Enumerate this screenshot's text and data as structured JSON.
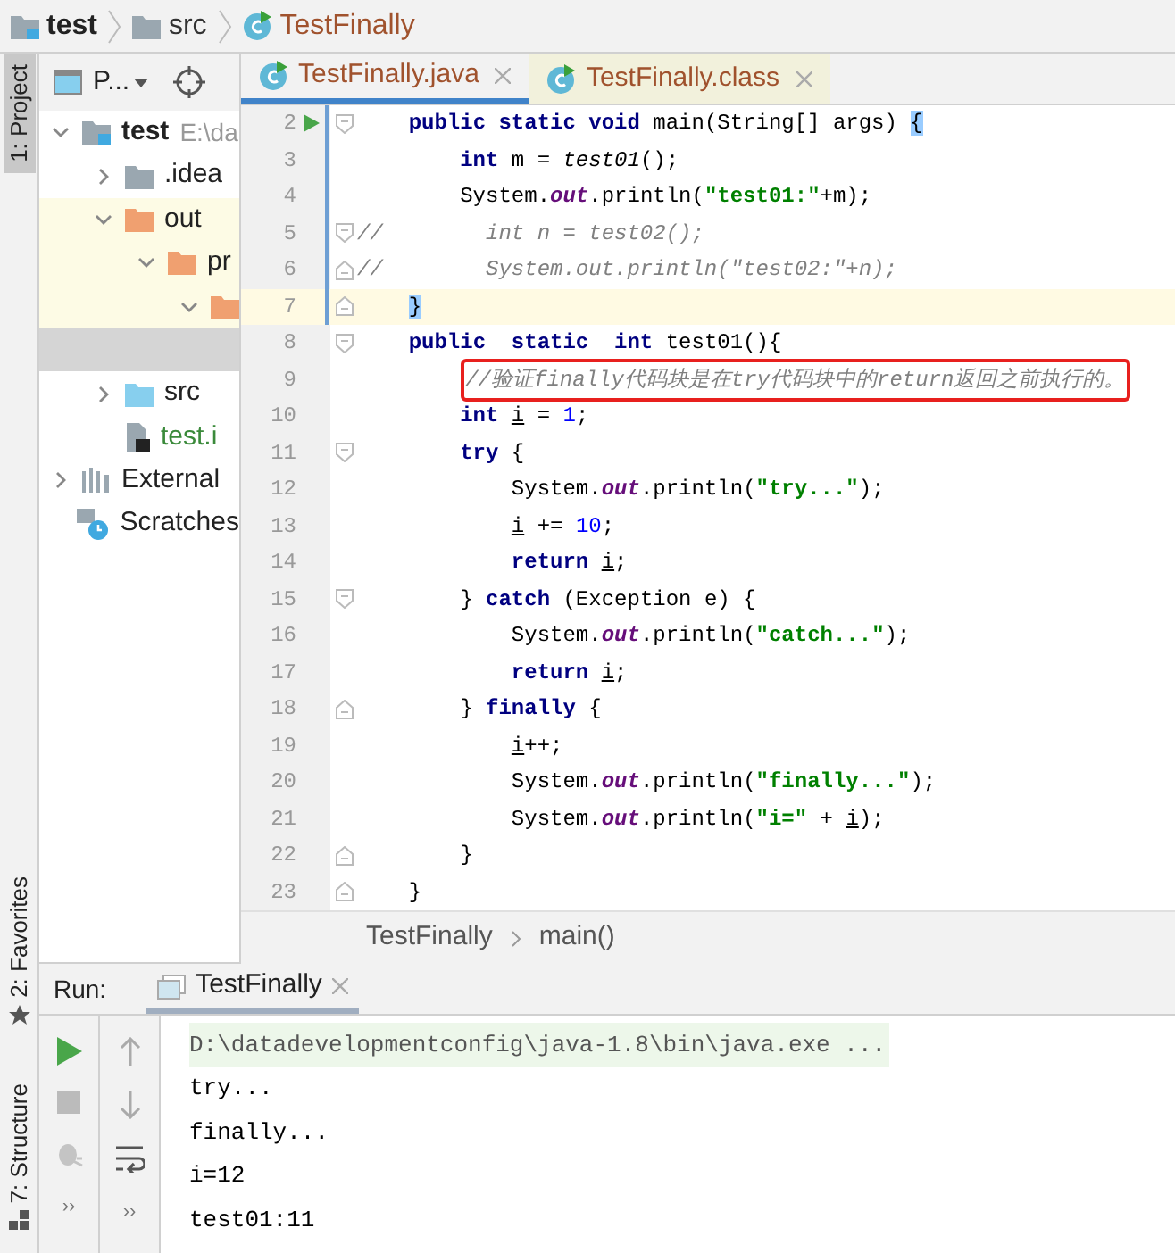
{
  "breadcrumb": [
    {
      "label": "test",
      "kind": "module"
    },
    {
      "label": "src",
      "kind": "folder"
    },
    {
      "label": "TestFinally",
      "kind": "class"
    }
  ],
  "side_tabs_top": [
    {
      "label": "1: Project",
      "selected": true
    }
  ],
  "side_tabs_bottom": [
    {
      "label": "2: Favorites",
      "kind": "star",
      "selected": false
    },
    {
      "label": "7: Structure",
      "kind": "structure",
      "selected": false
    }
  ],
  "project_panel": {
    "title": "P...",
    "tree": [
      {
        "label": "test",
        "hint": "E:\\da",
        "kind": "module",
        "expanded": true,
        "selected": false,
        "excluded": false,
        "children": [
          {
            "label": ".idea",
            "kind": "folder",
            "expanded": false,
            "selected": false,
            "excluded": false
          },
          {
            "label": "out",
            "kind": "excluded",
            "expanded": true,
            "selected": false,
            "excluded": true,
            "children": [
              {
                "label": "pr",
                "kind": "excluded",
                "expanded": true,
                "selected": false,
                "excluded": true,
                "children": [
                  {
                    "kind": "excluded",
                    "expanded": true,
                    "selected": false,
                    "excluded": true,
                    "children": [
                      {
                        "selected": true
                      }
                    ]
                  }
                ]
              }
            ]
          },
          {
            "label": "src",
            "kind": "source",
            "expanded": false,
            "selected": false,
            "excluded": false
          },
          {
            "label": "test.i",
            "kind": "file",
            "selected": false,
            "excluded": false,
            "green": true
          }
        ]
      },
      {
        "label": "External",
        "kind": "library",
        "expanded": false,
        "selected": false,
        "excluded": false
      },
      {
        "label": "Scratches",
        "kind": "scratches",
        "selected": false,
        "excluded": false
      }
    ]
  },
  "editor_tabs": [
    {
      "label": "TestFinally.java",
      "selected": true
    },
    {
      "label": "TestFinally.class",
      "selected": false
    }
  ],
  "code_lines": [
    {
      "number": "2",
      "run": true,
      "fold_open": true,
      "fold_close": false,
      "modified": true,
      "current": false,
      "annotated": false,
      "tokens": [
        {
          "kind": "kw",
          "text": "    public static void "
        },
        {
          "kind": "plain",
          "text": "main(String[] args) "
        },
        {
          "kind": "match",
          "text": "{"
        }
      ]
    },
    {
      "number": "3",
      "run": false,
      "fold_open": false,
      "fold_close": false,
      "modified": true,
      "current": false,
      "annotated": false,
      "tokens": [
        {
          "kind": "kw",
          "text": "        int "
        },
        {
          "kind": "plain",
          "text": "m = "
        },
        {
          "kind": "call",
          "text": "test01"
        },
        {
          "kind": "plain",
          "text": "();"
        }
      ]
    },
    {
      "number": "4",
      "run": false,
      "fold_open": false,
      "fold_close": false,
      "modified": true,
      "current": false,
      "annotated": false,
      "tokens": [
        {
          "kind": "plain",
          "text": "        System."
        },
        {
          "kind": "field",
          "text": "out"
        },
        {
          "kind": "plain",
          "text": ".println("
        },
        {
          "kind": "str",
          "text": "\"test01:\""
        },
        {
          "kind": "plain",
          "text": "+m);"
        }
      ]
    },
    {
      "number": "5",
      "run": false,
      "fold_open": true,
      "fold_close": false,
      "modified": true,
      "current": false,
      "annotated": false,
      "tokens": [
        {
          "kind": "comment",
          "text": "//        int n = test02();"
        }
      ]
    },
    {
      "number": "6",
      "run": false,
      "fold_open": false,
      "fold_close": true,
      "modified": true,
      "current": false,
      "annotated": false,
      "tokens": [
        {
          "kind": "comment",
          "text": "//        System.out.println(\"test02:\"+n);"
        }
      ]
    },
    {
      "number": "7",
      "run": false,
      "fold_open": false,
      "fold_close": true,
      "modified": true,
      "current": true,
      "annotated": false,
      "tokens": [
        {
          "kind": "match",
          "text": "    }"
        }
      ]
    },
    {
      "number": "8",
      "run": false,
      "fold_open": true,
      "fold_close": false,
      "modified": false,
      "current": false,
      "annotated": false,
      "tokens": [
        {
          "kind": "kw",
          "text": "    public  static  int "
        },
        {
          "kind": "plain",
          "text": "test01(){"
        }
      ]
    },
    {
      "number": "9",
      "run": false,
      "fold_open": false,
      "fold_close": false,
      "modified": false,
      "current": false,
      "annotated": true,
      "tokens": [
        {
          "kind": "comment",
          "text": "        //验证finally代码块是在try代码块中的return返回之前执行的。"
        }
      ]
    },
    {
      "number": "10",
      "run": false,
      "fold_open": false,
      "fold_close": false,
      "modified": false,
      "current": false,
      "annotated": false,
      "tokens": [
        {
          "kind": "kw",
          "text": "        int "
        },
        {
          "kind": "var",
          "text": "i"
        },
        {
          "kind": "plain",
          "text": " = "
        },
        {
          "kind": "num",
          "text": "1"
        },
        {
          "kind": "plain",
          "text": ";"
        }
      ]
    },
    {
      "number": "11",
      "run": false,
      "fold_open": true,
      "fold_close": false,
      "modified": false,
      "current": false,
      "annotated": false,
      "tokens": [
        {
          "kind": "kw",
          "text": "        try "
        },
        {
          "kind": "plain",
          "text": "{"
        }
      ]
    },
    {
      "number": "12",
      "run": false,
      "fold_open": false,
      "fold_close": false,
      "modified": false,
      "current": false,
      "annotated": false,
      "tokens": [
        {
          "kind": "plain",
          "text": "            System."
        },
        {
          "kind": "field",
          "text": "out"
        },
        {
          "kind": "plain",
          "text": ".println("
        },
        {
          "kind": "str",
          "text": "\"try...\""
        },
        {
          "kind": "plain",
          "text": ");"
        }
      ]
    },
    {
      "number": "13",
      "run": false,
      "fold_open": false,
      "fold_close": false,
      "modified": false,
      "current": false,
      "annotated": false,
      "tokens": [
        {
          "kind": "var",
          "text": "            i"
        },
        {
          "kind": "plain",
          "text": " += "
        },
        {
          "kind": "num",
          "text": "10"
        },
        {
          "kind": "plain",
          "text": ";"
        }
      ]
    },
    {
      "number": "14",
      "run": false,
      "fold_open": false,
      "fold_close": false,
      "modified": false,
      "current": false,
      "annotated": false,
      "tokens": [
        {
          "kind": "kw",
          "text": "            return "
        },
        {
          "kind": "var",
          "text": "i"
        },
        {
          "kind": "plain",
          "text": ";"
        }
      ]
    },
    {
      "number": "15",
      "run": false,
      "fold_open": true,
      "fold_close": false,
      "modified": false,
      "current": false,
      "annotated": false,
      "tokens": [
        {
          "kind": "plain",
          "text": "        } "
        },
        {
          "kind": "kw",
          "text": "catch "
        },
        {
          "kind": "plain",
          "text": "(Exception e) {"
        }
      ]
    },
    {
      "number": "16",
      "run": false,
      "fold_open": false,
      "fold_close": false,
      "modified": false,
      "current": false,
      "annotated": false,
      "tokens": [
        {
          "kind": "plain",
          "text": "            System."
        },
        {
          "kind": "field",
          "text": "out"
        },
        {
          "kind": "plain",
          "text": ".println("
        },
        {
          "kind": "str",
          "text": "\"catch...\""
        },
        {
          "kind": "plain",
          "text": ");"
        }
      ]
    },
    {
      "number": "17",
      "run": false,
      "fold_open": false,
      "fold_close": false,
      "modified": false,
      "current": false,
      "annotated": false,
      "tokens": [
        {
          "kind": "kw",
          "text": "            return "
        },
        {
          "kind": "var",
          "text": "i"
        },
        {
          "kind": "plain",
          "text": ";"
        }
      ]
    },
    {
      "number": "18",
      "run": false,
      "fold_open": false,
      "fold_close": true,
      "modified": false,
      "current": false,
      "annotated": false,
      "tokens": [
        {
          "kind": "plain",
          "text": "        } "
        },
        {
          "kind": "kw",
          "text": "finally "
        },
        {
          "kind": "plain",
          "text": "{"
        }
      ]
    },
    {
      "number": "19",
      "run": false,
      "fold_open": false,
      "fold_close": false,
      "modified": false,
      "current": false,
      "annotated": false,
      "tokens": [
        {
          "kind": "var",
          "text": "            i"
        },
        {
          "kind": "plain",
          "text": "++;"
        }
      ]
    },
    {
      "number": "20",
      "run": false,
      "fold_open": false,
      "fold_close": false,
      "modified": false,
      "current": false,
      "annotated": false,
      "tokens": [
        {
          "kind": "plain",
          "text": "            System."
        },
        {
          "kind": "field",
          "text": "out"
        },
        {
          "kind": "plain",
          "text": ".println("
        },
        {
          "kind": "str",
          "text": "\"finally...\""
        },
        {
          "kind": "plain",
          "text": ");"
        }
      ]
    },
    {
      "number": "21",
      "run": false,
      "fold_open": false,
      "fold_close": false,
      "modified": false,
      "current": false,
      "annotated": false,
      "tokens": [
        {
          "kind": "plain",
          "text": "            System."
        },
        {
          "kind": "field",
          "text": "out"
        },
        {
          "kind": "plain",
          "text": ".println("
        },
        {
          "kind": "str",
          "text": "\"i=\""
        },
        {
          "kind": "plain",
          "text": " + "
        },
        {
          "kind": "var",
          "text": "i"
        },
        {
          "kind": "plain",
          "text": ");"
        }
      ]
    },
    {
      "number": "22",
      "run": false,
      "fold_open": false,
      "fold_close": true,
      "modified": false,
      "current": false,
      "annotated": false,
      "tokens": [
        {
          "kind": "plain",
          "text": "        }"
        }
      ]
    },
    {
      "number": "23",
      "run": false,
      "fold_open": false,
      "fold_close": true,
      "modified": false,
      "current": false,
      "annotated": false,
      "tokens": [
        {
          "kind": "plain",
          "text": "    }"
        }
      ]
    }
  ],
  "editor_breadcrumb": [
    "TestFinally",
    "main()"
  ],
  "run_panel": {
    "label": "Run:",
    "tabs": [
      {
        "label": "TestFinally",
        "selected": true
      }
    ],
    "more_buttons": [
      "››",
      "››"
    ],
    "output": [
      {
        "kind": "command",
        "text": "D:\\datadevelopmentconfig\\java-1.8\\bin\\java.exe ..."
      },
      {
        "kind": "stdout",
        "text": "try..."
      },
      {
        "kind": "stdout",
        "text": "finally..."
      },
      {
        "kind": "stdout",
        "text": "i=12"
      },
      {
        "kind": "stdout",
        "text": "test01:11"
      }
    ]
  }
}
